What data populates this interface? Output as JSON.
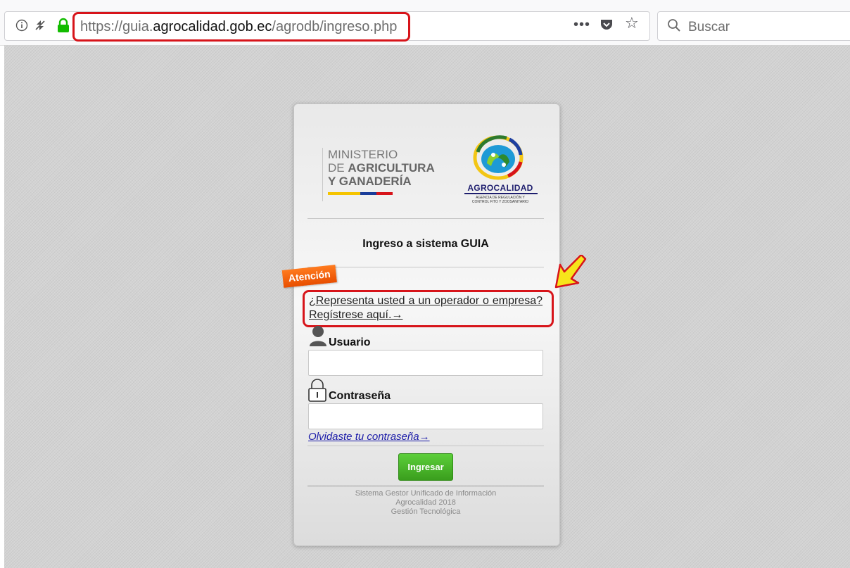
{
  "browser": {
    "url_scheme": "https://guia.",
    "url_host": "agrocalidad.gob.ec",
    "url_path": "/agrodb/ingreso.php",
    "more_label": "•••",
    "search_placeholder": "Buscar"
  },
  "logos": {
    "ministerio_line1": "MINISTERIO",
    "ministerio_line2_prefix": "DE ",
    "ministerio_line2_bold": "AGRICULTURA",
    "ministerio_line3": "Y GANADERÍA",
    "agrocalidad_name": "AGROCALIDAD",
    "agrocalidad_sub1": "AGENCIA DE REGULACIÓN Y",
    "agrocalidad_sub2": "CONTROL FITO Y ZOOSANITARIO",
    "flag_colors": [
      "#f5c400",
      "#1a3d9a",
      "#d7141a"
    ]
  },
  "login": {
    "title": "Ingreso a sistema GUIA",
    "attention_badge": "Atención",
    "register_link": "¿Representa usted a un operador o empresa? Regístrese aquí.→",
    "user_label": "Usuario",
    "password_label": "Contraseña",
    "forgot_link": "Olvidaste tu contraseña→",
    "submit_button": "Ingresar"
  },
  "footer": {
    "line1": "Sistema Gestor Unificado de Información",
    "line2": "Agrocalidad 2018",
    "line3": "Gestión Tecnológica"
  },
  "colors": {
    "highlight_red": "#d7141a",
    "attention_orange": "#f0630e",
    "button_green": "#4cb82b",
    "link_blue": "#1a1aa8"
  }
}
